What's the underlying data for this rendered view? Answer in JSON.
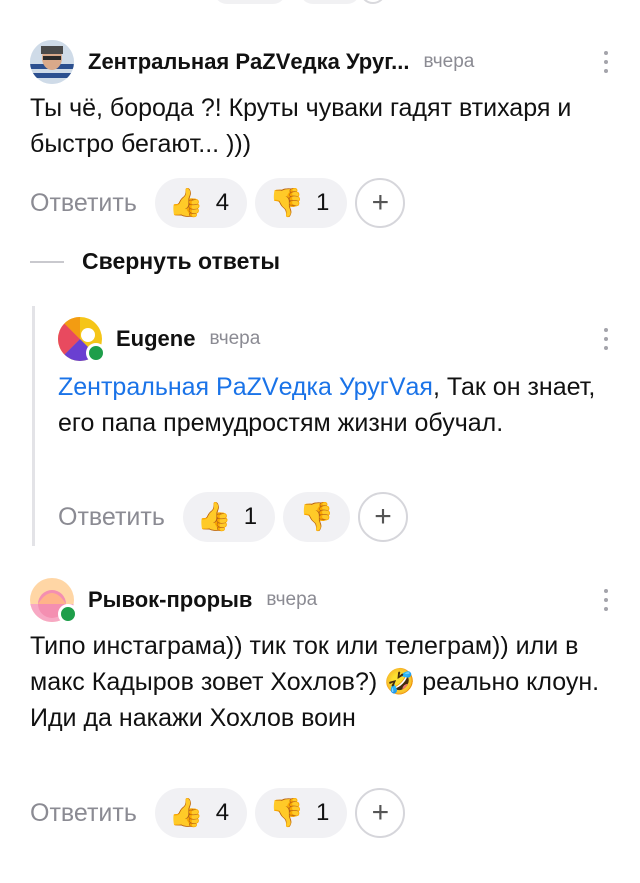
{
  "comments": [
    {
      "author": "Zентральная PaZVедка Уруг...",
      "time": "вчера",
      "text": "Ты чё, борода ?! Круты чуваки гадят втихаря и быстро бегают... )))",
      "reply_label": "Ответить",
      "likes": "4",
      "dislikes": "1",
      "avatar": "photo-avatar"
    },
    {
      "author": "Eugene",
      "time": "вчера",
      "mention": "Zентральная PaZVедка УругVая",
      "text": ", Так он знает, его папа премудростям жизни обучал.",
      "reply_label": "Ответить",
      "likes": "1",
      "dislikes": "",
      "avatar": "colorful-avatar",
      "online": true
    },
    {
      "author": "Рывок-прорыв",
      "time": "вчера",
      "text": "Типо инстаграма)) тик ток или телеграм)) или в макс Кадыров зовет Хохлов?) 🤣 реально клоун. Иди да накажи Хохлов воин",
      "reply_label": "Ответить",
      "likes": "4",
      "dislikes": "1",
      "avatar": "pink-avatar",
      "online": true
    }
  ],
  "thread": {
    "collapse_label": "Свернуть ответы"
  },
  "icons": {
    "like": "thumbs-up-icon",
    "dislike": "thumbs-down-icon",
    "add": "plus-icon",
    "more": "more-vertical-icon"
  },
  "reaction_glyphs": {
    "like": "👍",
    "dislike": "👎",
    "add": "+"
  },
  "colors": {
    "mention": "#1a73e8",
    "online": "#1e9e4a",
    "muted": "#8b8b93"
  }
}
